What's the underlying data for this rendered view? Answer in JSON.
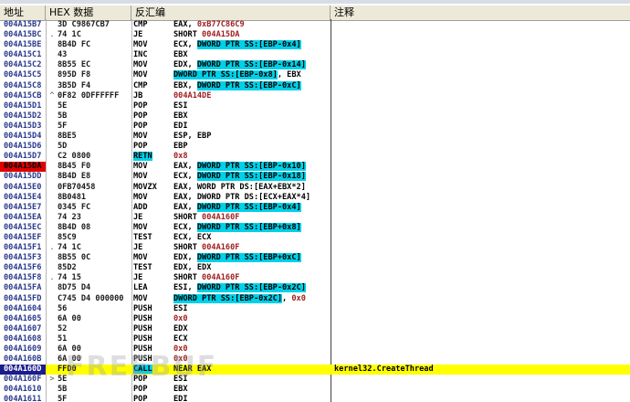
{
  "header": {
    "addr": "地址",
    "hex": "HEX 数据",
    "disasm": "反汇编",
    "comment": "注释"
  },
  "watermark": "FREEBUF",
  "colors": {
    "breakpoint": "#e00000",
    "current_row": "#ffff00",
    "current_addr_bg": "#1c1c8c",
    "operand_highlight": "#00d0e8",
    "jump_mnemonic": "#e00000",
    "stack_mnemonic": "#0000c8"
  },
  "rows": [
    {
      "addr": "004A15B7",
      "mark": "",
      "hex": "3D C9867CB7",
      "mn": "CMP",
      "ops": [
        {
          "t": "EAX, "
        },
        {
          "t": "0xB77C86C9",
          "c": "imm"
        }
      ]
    },
    {
      "addr": "004A15BC",
      "mark": ".",
      "hex": "74 1C",
      "mn": "JE",
      "mnc": "red",
      "ops": [
        {
          "t": "SHORT "
        },
        {
          "t": "004A15DA",
          "c": "imm"
        }
      ]
    },
    {
      "addr": "004A15BE",
      "mark": "",
      "hex": "8B4D FC",
      "mn": "MOV",
      "ops": [
        {
          "t": "ECX, "
        },
        {
          "t": "DWORD PTR SS:[EBP-0x4]",
          "c": "hl"
        }
      ]
    },
    {
      "addr": "004A15C1",
      "mark": "",
      "hex": "43",
      "mn": "INC",
      "ops": [
        {
          "t": "EBX"
        }
      ]
    },
    {
      "addr": "004A15C2",
      "mark": "",
      "hex": "8B55 EC",
      "mn": "MOV",
      "ops": [
        {
          "t": "EDX, "
        },
        {
          "t": "DWORD PTR SS:[EBP-0x14]",
          "c": "hl"
        }
      ]
    },
    {
      "addr": "004A15C5",
      "mark": "",
      "hex": "895D F8",
      "mn": "MOV",
      "ops": [
        {
          "t": "DWORD PTR SS:[EBP-0x8]",
          "c": "hl"
        },
        {
          "t": ", EBX"
        }
      ]
    },
    {
      "addr": "004A15C8",
      "mark": "",
      "hex": "3B5D F4",
      "mn": "CMP",
      "ops": [
        {
          "t": "EBX, "
        },
        {
          "t": "DWORD PTR SS:[EBP-0xC]",
          "c": "hl"
        }
      ]
    },
    {
      "addr": "004A15CB",
      "mark": "^",
      "hex": "0F82 0DFFFFFF",
      "mn": "JB",
      "mnc": "red",
      "ops": [
        {
          "t": "004A14DE",
          "c": "imm"
        }
      ]
    },
    {
      "addr": "004A15D1",
      "mark": "",
      "hex": "5E",
      "mn": "POP",
      "mnc": "blue",
      "ops": [
        {
          "t": "ESI"
        }
      ]
    },
    {
      "addr": "004A15D2",
      "mark": "",
      "hex": "5B",
      "mn": "POP",
      "mnc": "blue",
      "ops": [
        {
          "t": "EBX"
        }
      ]
    },
    {
      "addr": "004A15D3",
      "mark": "",
      "hex": "5F",
      "mn": "POP",
      "mnc": "blue",
      "ops": [
        {
          "t": "EDI"
        }
      ]
    },
    {
      "addr": "004A15D4",
      "mark": "",
      "hex": "8BE5",
      "mn": "MOV",
      "ops": [
        {
          "t": "ESP, EBP"
        }
      ]
    },
    {
      "addr": "004A15D6",
      "mark": "",
      "hex": "5D",
      "mn": "POP",
      "mnc": "blue",
      "ops": [
        {
          "t": "EBP"
        }
      ]
    },
    {
      "addr": "004A15D7",
      "mark": "",
      "hex": "C2 0800",
      "mn": "RETN",
      "mnc": "hl",
      "ops": [
        {
          "t": "0x8",
          "c": "imm"
        }
      ]
    },
    {
      "addr": "004A15DA",
      "mark": "",
      "hex": "8B45 F0",
      "mn": "MOV",
      "bp": true,
      "ops": [
        {
          "t": "EAX, "
        },
        {
          "t": "DWORD PTR SS:[EBP-0x10]",
          "c": "hl"
        }
      ]
    },
    {
      "addr": "004A15DD",
      "mark": "",
      "hex": "8B4D E8",
      "mn": "MOV",
      "ops": [
        {
          "t": "ECX, "
        },
        {
          "t": "DWORD PTR SS:[EBP-0x18]",
          "c": "hl"
        }
      ]
    },
    {
      "addr": "004A15E0",
      "mark": "",
      "hex": "0FB70458",
      "mn": "MOVZX",
      "ops": [
        {
          "t": "EAX, WORD PTR DS:[EAX+EBX*2]"
        }
      ]
    },
    {
      "addr": "004A15E4",
      "mark": "",
      "hex": "8B0481",
      "mn": "MOV",
      "ops": [
        {
          "t": "EAX, DWORD PTR DS:[ECX+EAX*4]"
        }
      ]
    },
    {
      "addr": "004A15E7",
      "mark": "",
      "hex": "0345 FC",
      "mn": "ADD",
      "ops": [
        {
          "t": "EAX, "
        },
        {
          "t": "DWORD PTR SS:[EBP-0x4]",
          "c": "hl"
        }
      ]
    },
    {
      "addr": "004A15EA",
      "mark": "",
      "hex": "74 23",
      "mn": "JE",
      "mnc": "red",
      "ops": [
        {
          "t": "SHORT "
        },
        {
          "t": "004A160F",
          "c": "imm"
        }
      ]
    },
    {
      "addr": "004A15EC",
      "mark": "",
      "hex": "8B4D 08",
      "mn": "MOV",
      "ops": [
        {
          "t": "ECX, "
        },
        {
          "t": "DWORD PTR SS:[EBP+0x8]",
          "c": "hl"
        }
      ]
    },
    {
      "addr": "004A15EF",
      "mark": "",
      "hex": "85C9",
      "mn": "TEST",
      "ops": [
        {
          "t": "ECX, ECX"
        }
      ]
    },
    {
      "addr": "004A15F1",
      "mark": ".",
      "hex": "74 1C",
      "mn": "JE",
      "mnc": "red",
      "ops": [
        {
          "t": "SHORT "
        },
        {
          "t": "004A160F",
          "c": "imm"
        }
      ]
    },
    {
      "addr": "004A15F3",
      "mark": "",
      "hex": "8B55 0C",
      "mn": "MOV",
      "ops": [
        {
          "t": "EDX, "
        },
        {
          "t": "DWORD PTR SS:[EBP+0xC]",
          "c": "hl"
        }
      ]
    },
    {
      "addr": "004A15F6",
      "mark": "",
      "hex": "85D2",
      "mn": "TEST",
      "ops": [
        {
          "t": "EDX, EDX"
        }
      ]
    },
    {
      "addr": "004A15F8",
      "mark": ".",
      "hex": "74 15",
      "mn": "JE",
      "mnc": "red",
      "ops": [
        {
          "t": "SHORT "
        },
        {
          "t": "004A160F",
          "c": "imm"
        }
      ]
    },
    {
      "addr": "004A15FA",
      "mark": "",
      "hex": "8D75 D4",
      "mn": "LEA",
      "ops": [
        {
          "t": "ESI, "
        },
        {
          "t": "DWORD PTR SS:[EBP-0x2C]",
          "c": "hl"
        }
      ]
    },
    {
      "addr": "004A15FD",
      "mark": "",
      "hex": "C745 D4 000000",
      "mn": "MOV",
      "ops": [
        {
          "t": "DWORD PTR SS:[EBP-0x2C]",
          "c": "hl"
        },
        {
          "t": ", "
        },
        {
          "t": "0x0",
          "c": "imm"
        }
      ]
    },
    {
      "addr": "004A1604",
      "mark": "",
      "hex": "56",
      "mn": "PUSH",
      "mnc": "blue",
      "ops": [
        {
          "t": "ESI"
        }
      ]
    },
    {
      "addr": "004A1605",
      "mark": "",
      "hex": "6A 00",
      "mn": "PUSH",
      "mnc": "blue",
      "ops": [
        {
          "t": "0x0",
          "c": "imm"
        }
      ]
    },
    {
      "addr": "004A1607",
      "mark": "",
      "hex": "52",
      "mn": "PUSH",
      "mnc": "blue",
      "ops": [
        {
          "t": "EDX"
        }
      ]
    },
    {
      "addr": "004A1608",
      "mark": "",
      "hex": "51",
      "mn": "PUSH",
      "mnc": "blue",
      "ops": [
        {
          "t": "ECX"
        }
      ]
    },
    {
      "addr": "004A1609",
      "mark": "",
      "hex": "6A 00",
      "mn": "PUSH",
      "mnc": "blue",
      "ops": [
        {
          "t": "0x0",
          "c": "imm"
        }
      ]
    },
    {
      "addr": "004A160B",
      "mark": "",
      "hex": "6A 00",
      "mn": "PUSH",
      "mnc": "blue",
      "ops": [
        {
          "t": "0x0",
          "c": "imm"
        }
      ]
    },
    {
      "addr": "004A160D",
      "mark": "",
      "hex": "FFD0",
      "mn": "CALL",
      "mnc": "hl",
      "current": true,
      "ops": [
        {
          "t": "NEAR EAX"
        }
      ],
      "comment": "kernel32.CreateThread"
    },
    {
      "addr": "004A160F",
      "mark": ">",
      "hex": "5E",
      "mn": "POP",
      "mnc": "blue",
      "ops": [
        {
          "t": "ESI"
        }
      ]
    },
    {
      "addr": "004A1610",
      "mark": "",
      "hex": "5B",
      "mn": "POP",
      "mnc": "blue",
      "ops": [
        {
          "t": "EBX"
        }
      ]
    },
    {
      "addr": "004A1611",
      "mark": "",
      "hex": "5F",
      "mn": "POP",
      "mnc": "blue",
      "ops": [
        {
          "t": "EDI"
        }
      ]
    }
  ]
}
